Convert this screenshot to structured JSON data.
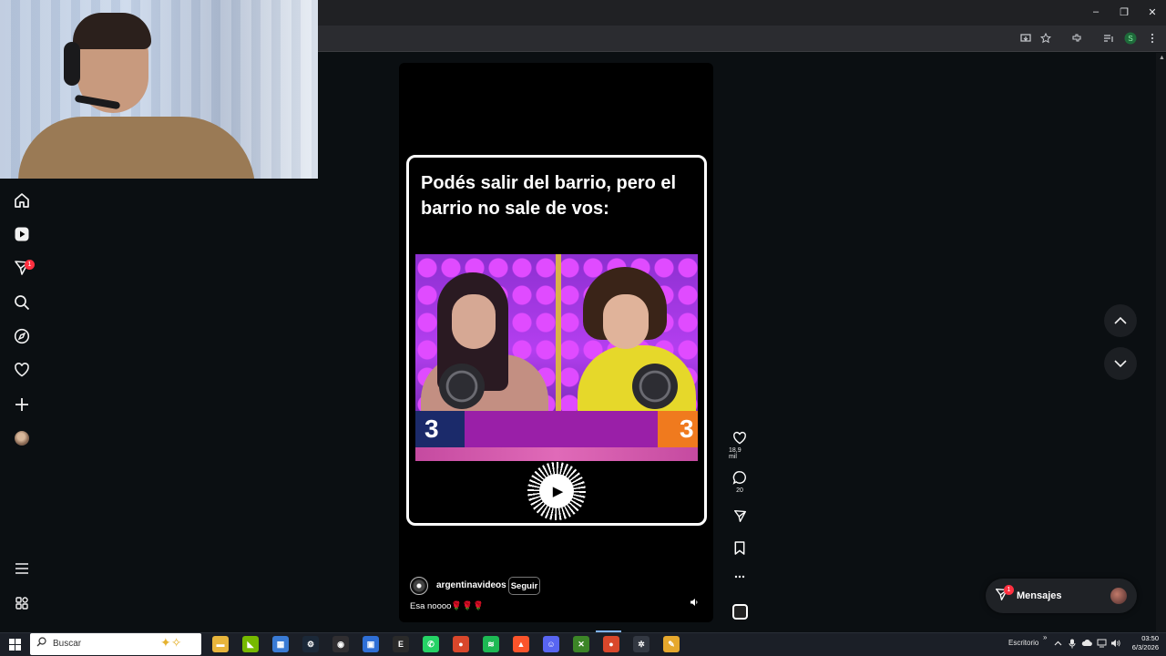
{
  "browser": {
    "window_controls": {
      "minimize": "–",
      "restore": "❐",
      "close": "✕"
    }
  },
  "sidebar": {
    "items": [
      {
        "name": "Inicio",
        "icon": "home-icon"
      },
      {
        "name": "Reels",
        "icon": "reels-icon"
      },
      {
        "name": "Mensajes",
        "icon": "send-icon",
        "badge": "1"
      },
      {
        "name": "Buscar",
        "icon": "search-icon"
      },
      {
        "name": "Explorar",
        "icon": "compass-icon"
      },
      {
        "name": "Notificaciones",
        "icon": "heart-icon"
      },
      {
        "name": "Crear",
        "icon": "plus-icon"
      },
      {
        "name": "Perfil",
        "icon": "avatar"
      }
    ],
    "more_icon": "menu-icon",
    "also_icon": "meta-apps-icon"
  },
  "reel": {
    "caption_title": "Podés salir del barrio, pero el barrio no sale de vos:",
    "score_left": "3",
    "score_right": "3",
    "author": "argentinavideos",
    "follow_label": "Seguir",
    "text": "Esa noooo🌹🌹🌹",
    "actions": {
      "likes": "18,9 mil",
      "comments": "20"
    }
  },
  "messages": {
    "label": "Mensajes",
    "badge": "1"
  },
  "taskbar": {
    "search_placeholder": "Buscar",
    "desktop_label": "Escritorio",
    "time": "03:50",
    "date": "6/3/2026",
    "apps": [
      {
        "name": "file-explorer",
        "color": "#e8b53c",
        "glyph": "▬"
      },
      {
        "name": "nvidia",
        "color": "#76b900",
        "glyph": "◣"
      },
      {
        "name": "store",
        "color": "#3a7bd5",
        "glyph": "▦"
      },
      {
        "name": "steam",
        "color": "#1b2838",
        "glyph": "⚙"
      },
      {
        "name": "obs",
        "color": "#302e31",
        "glyph": "◉"
      },
      {
        "name": "notes",
        "color": "#2f6fd6",
        "glyph": "▣"
      },
      {
        "name": "epic",
        "color": "#2a2a2a",
        "glyph": "E"
      },
      {
        "name": "whatsapp",
        "color": "#25d366",
        "glyph": "✆"
      },
      {
        "name": "chrome",
        "color": "#d9472b",
        "glyph": "●"
      },
      {
        "name": "spotify",
        "color": "#1db954",
        "glyph": "≋"
      },
      {
        "name": "brave",
        "color": "#fb542b",
        "glyph": "▲"
      },
      {
        "name": "discord",
        "color": "#5865f2",
        "glyph": "☺"
      },
      {
        "name": "minecraft",
        "color": "#3c8527",
        "glyph": "✕"
      },
      {
        "name": "chrome-2",
        "color": "#d9472b",
        "glyph": "●"
      },
      {
        "name": "settings",
        "color": "#333842",
        "glyph": "✲"
      },
      {
        "name": "vscode-like",
        "color": "#e6a82d",
        "glyph": "✎"
      }
    ]
  },
  "colors": {
    "accent_badge": "#ff3040",
    "page_bg": "#0b0f12",
    "reel_bg": "#000000"
  }
}
